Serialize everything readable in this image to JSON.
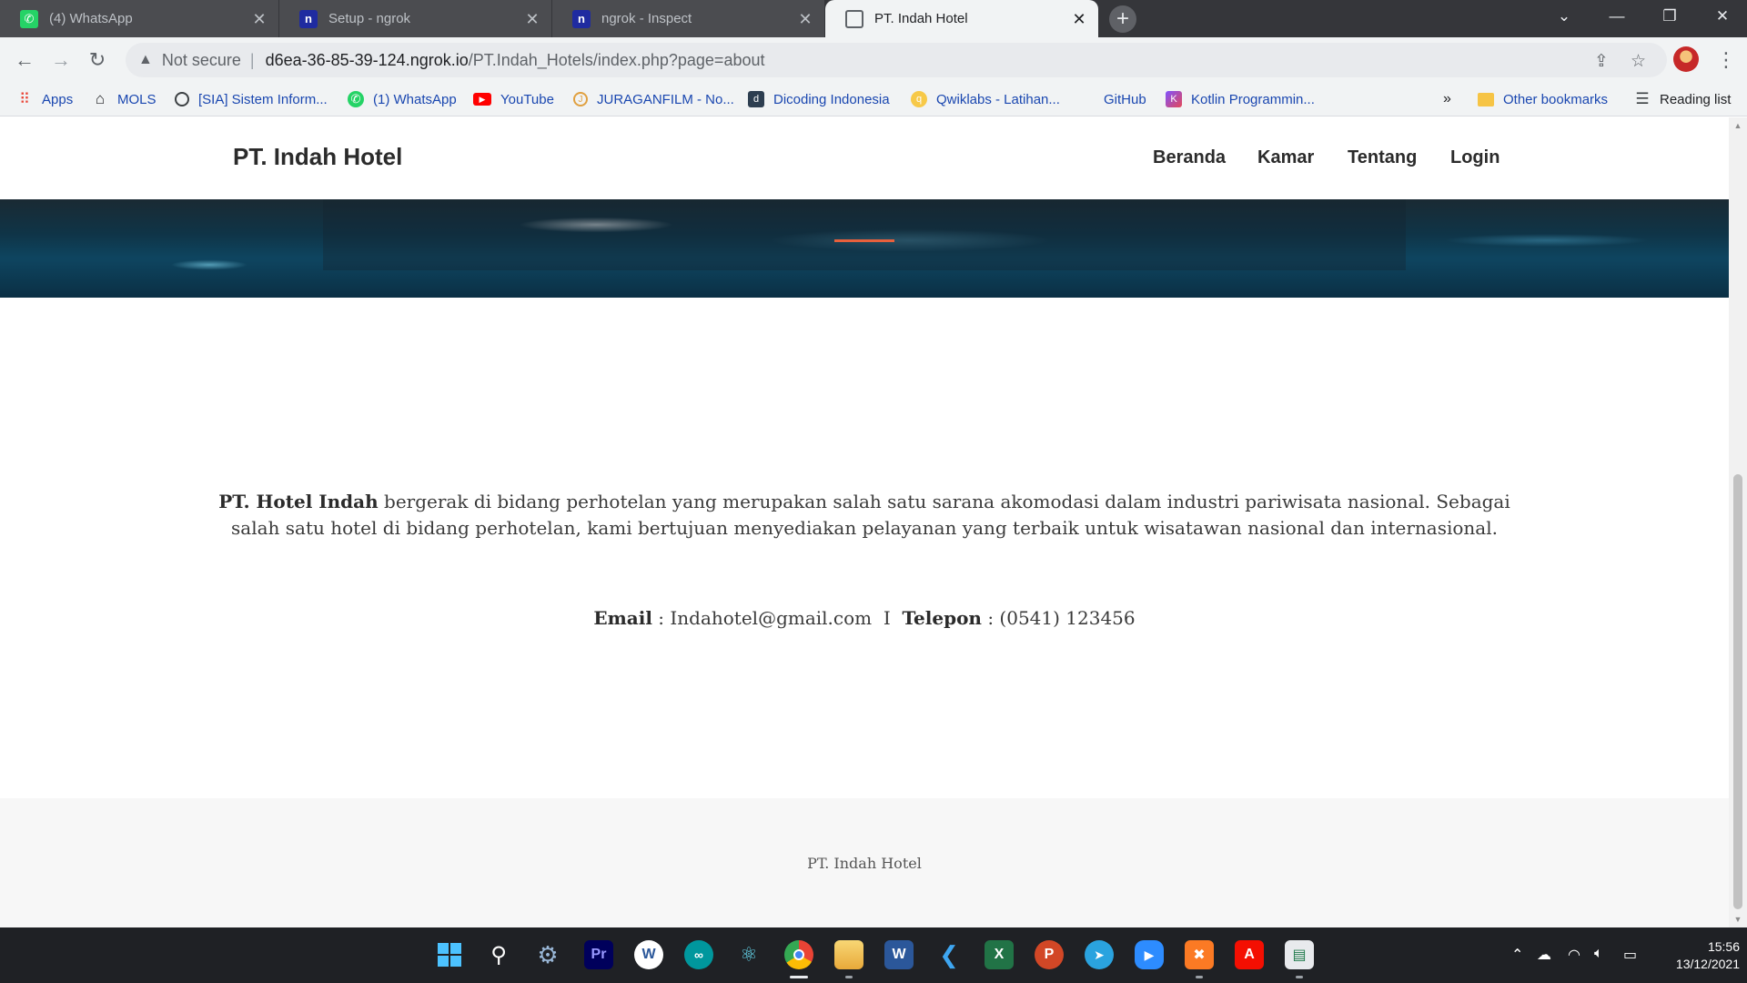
{
  "browser": {
    "tabs": [
      {
        "title": "(4) WhatsApp",
        "icon": "whatsapp-icon",
        "state": "inactive"
      },
      {
        "title": "Setup - ngrok",
        "icon": "ngrok-icon",
        "state": "inactive"
      },
      {
        "title": "ngrok - Inspect",
        "icon": "ngrok-icon",
        "state": "inactive"
      },
      {
        "title": "PT. Indah Hotel",
        "icon": "globe-icon",
        "state": "active"
      }
    ],
    "tab_close_glyph": "✕",
    "new_tab_glyph": "+",
    "address": {
      "security_label": "Not secure",
      "separator": "|",
      "host": "d6ea-36-85-39-124.ngrok.io",
      "path": "/PT.Indah_Hotels/index.php?page=about"
    },
    "bookmarks": [
      {
        "label": "Apps",
        "icon": "apps-grid-icon"
      },
      {
        "label": "MOLS",
        "icon": "home-icon"
      },
      {
        "label": "[SIA] Sistem Inform...",
        "icon": "globe-icon"
      },
      {
        "label": "(1) WhatsApp",
        "icon": "whatsapp-icon"
      },
      {
        "label": "YouTube",
        "icon": "youtube-icon"
      },
      {
        "label": "JURAGANFILM - No...",
        "icon": "juraganfilm-icon"
      },
      {
        "label": "Dicoding Indonesia",
        "icon": "dicoding-icon"
      },
      {
        "label": "Qwiklabs - Latihan...",
        "icon": "qwiklabs-icon"
      },
      {
        "label": "GitHub",
        "icon": "github-icon"
      },
      {
        "label": "Kotlin Programmin...",
        "icon": "kotlin-icon"
      }
    ],
    "bookmarks_overflow": "»",
    "other_bookmarks": "Other bookmarks",
    "reading_list": "Reading list"
  },
  "site": {
    "brand": "PT. Indah Hotel",
    "nav": [
      "Beranda",
      "Kamar",
      "Tentang",
      "Login"
    ],
    "about": {
      "company": "PT. Hotel Indah",
      "body": " bergerak di bidang perhotelan yang merupakan salah satu sarana akomodasi dalam industri pariwisata nasional. Sebagai salah satu hotel di bidang perhotelan, kami bertujuan menyediakan pelayanan yang terbaik untuk wisatawan nasional dan internasional."
    },
    "contact": {
      "email_label": "Email",
      "email_value": " : Indahotel@gmail.com",
      "divider": "I",
      "phone_label": "Telepon",
      "phone_value": " : (0541) 123456"
    },
    "footer": "PT. Indah Hotel",
    "accent_color": "#e8603c"
  },
  "taskbar": {
    "apps": [
      "windows-start",
      "search",
      "settings",
      "premiere-pro",
      "word-icon-app",
      "arduino",
      "atom",
      "chrome",
      "file-explorer",
      "word",
      "vscode",
      "excel",
      "powerpoint",
      "telegram",
      "zoom",
      "xampp",
      "acrobat",
      "notepad"
    ],
    "clock_time": "15:56",
    "clock_date": "13/12/2021"
  }
}
